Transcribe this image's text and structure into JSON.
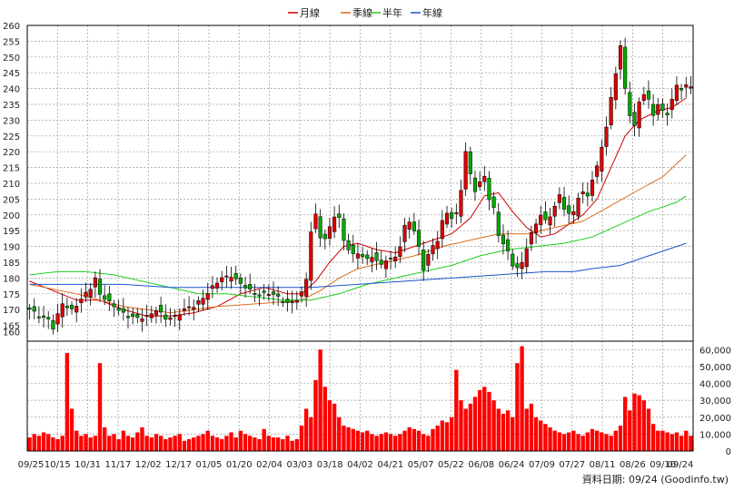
{
  "legend": [
    {
      "name": "月線",
      "color": "#cc0000"
    },
    {
      "name": "季線",
      "color": "#e06c1a"
    },
    {
      "name": "半年",
      "color": "#22cc22"
    },
    {
      "name": "年線",
      "color": "#1a55cc"
    }
  ],
  "source_label": "資料日期: 09/24  (Goodinfo.tw)",
  "chart_data": [
    {
      "type": "candlestick",
      "title": "",
      "x_tick_labels": [
        "09/25",
        "10/15",
        "10/31",
        "11/17",
        "12/02",
        "12/17",
        "01/05",
        "01/20",
        "02/04",
        "03/03",
        "03/18",
        "04/02",
        "04/21",
        "05/07",
        "05/22",
        "06/08",
        "06/24",
        "07/09",
        "07/27",
        "08/11",
        "08/26",
        "09/10",
        "09/24"
      ],
      "ylim": [
        160,
        260
      ],
      "y_ticks": [
        160,
        165,
        170,
        175,
        180,
        185,
        190,
        195,
        200,
        205,
        210,
        215,
        220,
        225,
        230,
        235,
        240,
        245,
        250,
        255,
        260
      ],
      "grid": true,
      "colors": {
        "up": "#dd0000",
        "down": "#00aa00"
      },
      "close_path": [
        [
          0,
          170
        ],
        [
          2,
          168
        ],
        [
          4,
          167
        ],
        [
          5,
          164
        ],
        [
          6,
          168
        ],
        [
          7,
          172
        ],
        [
          9,
          170
        ],
        [
          11,
          173
        ],
        [
          13,
          177
        ],
        [
          14,
          180
        ],
        [
          15,
          175
        ],
        [
          17,
          172
        ],
        [
          19,
          170
        ],
        [
          21,
          168
        ],
        [
          23,
          167
        ],
        [
          25,
          168
        ],
        [
          27,
          170
        ],
        [
          29,
          167
        ],
        [
          31,
          168
        ],
        [
          33,
          170
        ],
        [
          35,
          171
        ],
        [
          37,
          174
        ],
        [
          39,
          177
        ],
        [
          41,
          180
        ],
        [
          43,
          181
        ],
        [
          45,
          178
        ],
        [
          47,
          176
        ],
        [
          49,
          175
        ],
        [
          51,
          175
        ],
        [
          53,
          174
        ],
        [
          55,
          172
        ],
        [
          57,
          173
        ],
        [
          58,
          175
        ],
        [
          59,
          180
        ],
        [
          60,
          195
        ],
        [
          61,
          200
        ],
        [
          62,
          193
        ],
        [
          63,
          192
        ],
        [
          64,
          196
        ],
        [
          65,
          200
        ],
        [
          66,
          199
        ],
        [
          67,
          192
        ],
        [
          68,
          189
        ],
        [
          69,
          187
        ],
        [
          70,
          188
        ],
        [
          71,
          187
        ],
        [
          72,
          186
        ],
        [
          73,
          187
        ],
        [
          74,
          185
        ],
        [
          75,
          184
        ],
        [
          76,
          186
        ],
        [
          77,
          186
        ],
        [
          78,
          187
        ],
        [
          79,
          190
        ],
        [
          80,
          196
        ],
        [
          81,
          198
        ],
        [
          82,
          195
        ],
        [
          83,
          190
        ],
        [
          84,
          183
        ],
        [
          85,
          187
        ],
        [
          86,
          190
        ],
        [
          87,
          192
        ],
        [
          88,
          198
        ],
        [
          89,
          201
        ],
        [
          90,
          199
        ],
        [
          91,
          200
        ],
        [
          92,
          208
        ],
        [
          93,
          220
        ],
        [
          94,
          213
        ],
        [
          95,
          208
        ],
        [
          96,
          210
        ],
        [
          97,
          212
        ],
        [
          98,
          205
        ],
        [
          99,
          202
        ],
        [
          100,
          194
        ],
        [
          101,
          191
        ],
        [
          102,
          188
        ],
        [
          103,
          184
        ],
        [
          104,
          183
        ],
        [
          105,
          185
        ],
        [
          106,
          190
        ],
        [
          107,
          194
        ],
        [
          108,
          197
        ],
        [
          109,
          200
        ],
        [
          110,
          198
        ],
        [
          111,
          200
        ],
        [
          112,
          203
        ],
        [
          113,
          206
        ],
        [
          114,
          202
        ],
        [
          115,
          200
        ],
        [
          116,
          201
        ],
        [
          117,
          206
        ],
        [
          118,
          207
        ],
        [
          119,
          206
        ],
        [
          120,
          211
        ],
        [
          121,
          215
        ],
        [
          122,
          222
        ],
        [
          123,
          228
        ],
        [
          124,
          237
        ],
        [
          125,
          245
        ],
        [
          126,
          253
        ],
        [
          127,
          240
        ],
        [
          128,
          232
        ],
        [
          129,
          228
        ],
        [
          130,
          236
        ],
        [
          131,
          238
        ],
        [
          132,
          236
        ],
        [
          133,
          232
        ],
        [
          134,
          235
        ],
        [
          135,
          233
        ],
        [
          136,
          232
        ],
        [
          137,
          236
        ],
        [
          138,
          241
        ],
        [
          139,
          240
        ],
        [
          140,
          241
        ]
      ],
      "ma_series": [
        {
          "name": "月線",
          "points": [
            [
              0,
              179
            ],
            [
              5,
              176
            ],
            [
              10,
              173
            ],
            [
              15,
              173
            ],
            [
              20,
              170
            ],
            [
              25,
              168
            ],
            [
              30,
              168
            ],
            [
              35,
              169
            ],
            [
              40,
              171
            ],
            [
              45,
              175
            ],
            [
              50,
              177
            ],
            [
              55,
              175
            ],
            [
              58,
              175
            ],
            [
              61,
              179
            ],
            [
              64,
              185
            ],
            [
              67,
              190
            ],
            [
              70,
              191
            ],
            [
              74,
              189
            ],
            [
              78,
              188
            ],
            [
              82,
              190
            ],
            [
              86,
              192
            ],
            [
              90,
              194
            ],
            [
              94,
              199
            ],
            [
              97,
              206
            ],
            [
              100,
              207
            ],
            [
              103,
              201
            ],
            [
              106,
              196
            ],
            [
              109,
              193
            ],
            [
              112,
              194
            ],
            [
              115,
              197
            ],
            [
              118,
              200
            ],
            [
              121,
              205
            ],
            [
              124,
              215
            ],
            [
              127,
              225
            ],
            [
              130,
              230
            ],
            [
              134,
              233
            ],
            [
              137,
              234
            ],
            [
              140,
              237
            ]
          ]
        },
        {
          "name": "季線",
          "points": [
            [
              0,
              178
            ],
            [
              10,
              175
            ],
            [
              20,
              171
            ],
            [
              30,
              169
            ],
            [
              40,
              171
            ],
            [
              50,
              172
            ],
            [
              58,
              173
            ],
            [
              62,
              176
            ],
            [
              66,
              180
            ],
            [
              70,
              183
            ],
            [
              76,
              185
            ],
            [
              82,
              187
            ],
            [
              88,
              190
            ],
            [
              94,
              192
            ],
            [
              100,
              194
            ],
            [
              106,
              194
            ],
            [
              112,
              196
            ],
            [
              118,
              198
            ],
            [
              124,
              203
            ],
            [
              130,
              208
            ],
            [
              135,
              212
            ],
            [
              140,
              219
            ]
          ]
        },
        {
          "name": "半年",
          "points": [
            [
              0,
              181
            ],
            [
              6,
              182
            ],
            [
              12,
              182
            ],
            [
              18,
              181
            ],
            [
              24,
              179
            ],
            [
              30,
              177
            ],
            [
              36,
              175
            ],
            [
              42,
              175
            ],
            [
              48,
              174
            ],
            [
              54,
              173
            ],
            [
              60,
              173
            ],
            [
              66,
              175
            ],
            [
              72,
              178
            ],
            [
              78,
              180
            ],
            [
              84,
              182
            ],
            [
              90,
              184
            ],
            [
              96,
              187
            ],
            [
              102,
              189
            ],
            [
              108,
              190
            ],
            [
              114,
              191
            ],
            [
              120,
              193
            ],
            [
              126,
              197
            ],
            [
              132,
              201
            ],
            [
              138,
              204
            ],
            [
              140,
              206
            ]
          ]
        },
        {
          "name": "年線",
          "points": [
            [
              0,
              178
            ],
            [
              10,
              178
            ],
            [
              20,
              178
            ],
            [
              30,
              177
            ],
            [
              40,
              177
            ],
            [
              50,
              177
            ],
            [
              60,
              177
            ],
            [
              70,
              178
            ],
            [
              80,
              179
            ],
            [
              90,
              180
            ],
            [
              100,
              181
            ],
            [
              110,
              182
            ],
            [
              116,
              182
            ],
            [
              120,
              183
            ],
            [
              126,
              184
            ],
            [
              132,
              187
            ],
            [
              138,
              190
            ],
            [
              140,
              191
            ]
          ]
        }
      ]
    },
    {
      "type": "bar",
      "title": "",
      "x_tick_labels": [
        "09/25",
        "10/15",
        "10/31",
        "11/17",
        "12/02",
        "12/17",
        "01/05",
        "01/20",
        "02/04",
        "03/03",
        "03/18",
        "04/02",
        "04/21",
        "05/07",
        "05/22",
        "06/08",
        "06/24",
        "07/09",
        "07/27",
        "08/11",
        "08/26",
        "09/10",
        "09/24"
      ],
      "ylim": [
        0,
        65000
      ],
      "y_ticks": [
        0,
        10000,
        20000,
        30000,
        40000,
        50000,
        60000
      ],
      "y_tick_labels": [
        "0",
        "10,000",
        "20,000",
        "30,000",
        "40,000",
        "50,000",
        "60,000"
      ],
      "color": "#ff0000",
      "values": [
        8000,
        10000,
        9000,
        11000,
        10000,
        8000,
        7000,
        9000,
        58000,
        25000,
        12000,
        9000,
        10000,
        8000,
        9000,
        52000,
        14000,
        9000,
        10000,
        7000,
        12000,
        9000,
        8000,
        11000,
        14000,
        9000,
        8000,
        10000,
        9000,
        7000,
        8000,
        9000,
        10000,
        6000,
        7000,
        8000,
        9000,
        10000,
        12000,
        9000,
        8000,
        7000,
        9000,
        11000,
        8000,
        12000,
        10000,
        9000,
        8000,
        7000,
        13000,
        9000,
        8000,
        8000,
        7000,
        9000,
        6000,
        7000,
        15000,
        25000,
        20000,
        42000,
        60000,
        38000,
        30000,
        28000,
        20000,
        15000,
        14000,
        13000,
        12000,
        11000,
        12000,
        10000,
        9000,
        10000,
        11000,
        10000,
        9000,
        10000,
        12000,
        14000,
        13000,
        12000,
        10000,
        9000,
        13000,
        15000,
        18000,
        17000,
        20000,
        48000,
        30000,
        25000,
        28000,
        32000,
        36000,
        38000,
        35000,
        30000,
        25000,
        22000,
        24000,
        20000,
        52000,
        62000,
        25000,
        28000,
        20000,
        18000,
        16000,
        14000,
        12000,
        11000,
        10000,
        11000,
        12000,
        10000,
        9000,
        11000,
        13000,
        12000,
        11000,
        10000,
        9000,
        12000,
        15000,
        32000,
        24000,
        34000,
        33000,
        30000,
        25000,
        16000,
        12000,
        12000,
        11000,
        10000,
        11000,
        9000,
        12000,
        9000
      ]
    }
  ]
}
